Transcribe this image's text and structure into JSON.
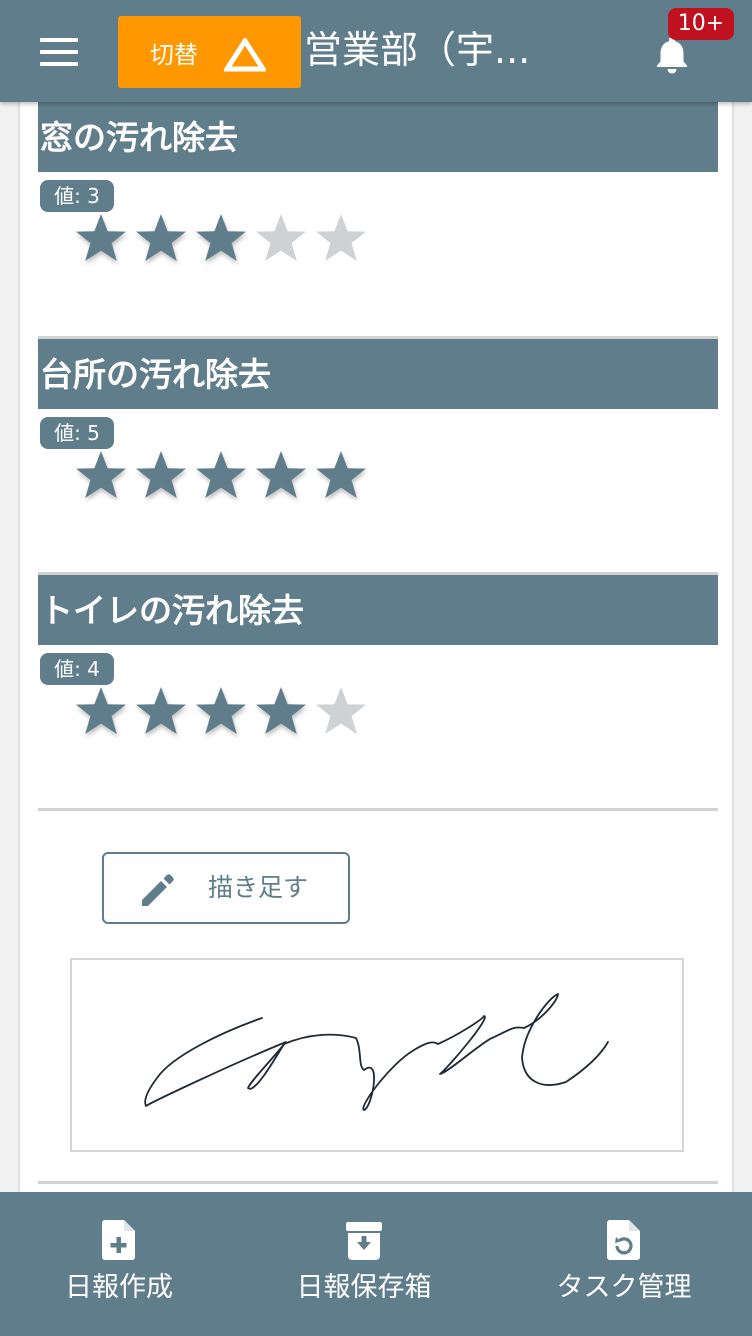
{
  "header": {
    "switch_label": "切替",
    "title": "営業部（宇...",
    "notification_badge": "10+"
  },
  "ratings": [
    {
      "title": "窓の汚れ除去",
      "value_label": "値: 3",
      "value": 3,
      "max": 5
    },
    {
      "title": "台所の汚れ除去",
      "value_label": "値: 5",
      "value": 5,
      "max": 5
    },
    {
      "title": "トイレの汚れ除去",
      "value_label": "値: 4",
      "value": 4,
      "max": 5
    }
  ],
  "signature": {
    "draw_button_label": "描き足す"
  },
  "bottom_nav": {
    "items": [
      {
        "label": "日報作成",
        "icon": "file-plus-icon"
      },
      {
        "label": "日報保存箱",
        "icon": "archive-box-icon"
      },
      {
        "label": "タスク管理",
        "icon": "file-refresh-icon"
      }
    ]
  },
  "colors": {
    "primary": "#607d8b",
    "accent": "#ff9800",
    "badge": "#c0111f",
    "star_off": "#cfd2d4"
  }
}
